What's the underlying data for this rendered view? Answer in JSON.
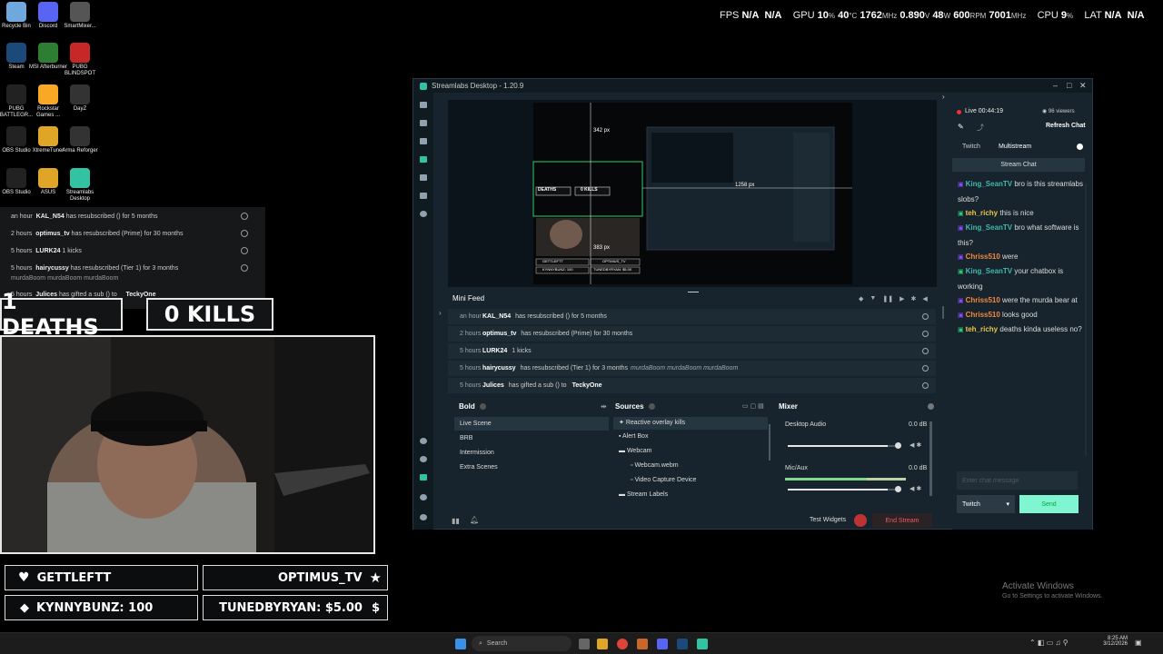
{
  "desktop_icons": [
    {
      "label": "Recycle Bin",
      "color": "#6fa8dc"
    },
    {
      "label": "Discord",
      "color": "#5865f2"
    },
    {
      "label": "SmartMixer...",
      "color": "#555"
    },
    {
      "label": "Steam",
      "color": "#1b4a7a"
    },
    {
      "label": "MSI Afterburner",
      "color": "#2d7d32"
    },
    {
      "label": "PUBG BLINDSPOT",
      "color": "#c62828"
    },
    {
      "label": "PUBG BATTLEGR...",
      "color": "#222"
    },
    {
      "label": "Rockstar Games ...",
      "color": "#f9a825"
    },
    {
      "label": "DayZ",
      "color": "#333"
    },
    {
      "label": "OBS Studio",
      "color": "#222"
    },
    {
      "label": "XtremeTuner",
      "color": "#e0a526"
    },
    {
      "label": "Arma Reforger",
      "color": "#333"
    },
    {
      "label": "OBS Studio",
      "color": "#222"
    },
    {
      "label": "ASUS",
      "color": "#e0a526"
    },
    {
      "label": "Streamlabs Desktop",
      "color": "#31c3a2"
    }
  ],
  "overlay_stats": {
    "fps_label": "FPS",
    "fps": "N/A",
    "fps2": "N/A",
    "gpu_label": "GPU",
    "gpu_pct": "10",
    "gpu_temp": "40",
    "gpu_clock": "1762",
    "gpu_volt": "0.890",
    "gpu_watt": "48",
    "gpu_rpm": "600",
    "gpu_mem": "7001",
    "cpu_label": "CPU",
    "cpu_pct": "9",
    "lat_label": "LAT",
    "lat": "N/A",
    "lat2": "N/A",
    "u_pct": "%",
    "u_temp": "°C",
    "u_mhz": "MHz",
    "u_v": "V",
    "u_w": "W",
    "u_rpm": "RPM"
  },
  "ghost_feed": [
    {
      "time": "an hour",
      "name": "KAL_N54",
      "text": "has resubscribed () for 5 months"
    },
    {
      "time": "2 hours",
      "name": "optimus_tv",
      "text": "has resubscribed (Prime) for 30 months"
    },
    {
      "time": "5 hours",
      "name": "LURK24",
      "text": "1 kicks"
    },
    {
      "time": "5 hours",
      "name": "hairycussy",
      "text": "has resubscribed (Tier 1) for 3 months"
    },
    {
      "time": "",
      "name": "",
      "text": "murdaBoom murdaBoom murdaBoom"
    },
    {
      "time": "5 hours",
      "name": "Julices",
      "text": "has gifted a sub () to"
    },
    {
      "time": "",
      "name": "TeckyOne",
      "text": ""
    }
  ],
  "counters": {
    "deaths": "1 DEATHS",
    "kills": "0 KILLS"
  },
  "labels": {
    "follower": "GETTLEFTT",
    "subscriber": "OPTIMUS_TV",
    "bits": "KYNNYBUNZ: 100",
    "donation": "TUNEDBYRYAN: $5.00",
    "dollar": "$"
  },
  "window": {
    "title": "Streamlabs Desktop - 1.20.9"
  },
  "preview": {
    "h_px": "342 px",
    "w_px": "1258 px",
    "h2_px": "383 px",
    "mini_deaths": "DEATHS",
    "mini_kills": "0 KILLS",
    "mini_follower": "GETTLEFTT",
    "mini_sub": "OPTIMUS_TV",
    "mini_bits": "KYNNYBUNZ: 100",
    "mini_don": "TUNEDBYRYAN: $5.00"
  },
  "mini_feed": {
    "title": "Mini Feed",
    "rows": [
      {
        "time": "an hour",
        "name": "KAL_N54",
        "text": "has resubscribed () for 5 months",
        "extra": "",
        "target": ""
      },
      {
        "time": "2 hours",
        "name": "optimus_tv",
        "text": "has resubscribed (Prime) for 30 months",
        "extra": "",
        "target": ""
      },
      {
        "time": "5 hours",
        "name": "LURK24",
        "text": "1 kicks",
        "extra": "",
        "target": ""
      },
      {
        "time": "5 hours",
        "name": "hairycussy",
        "text": "has resubscribed (Tier 1) for 3 months",
        "extra": "murdaBoom murdaBoom murdaBoom",
        "target": ""
      },
      {
        "time": "5 hours",
        "name": "Julices",
        "text": "has gifted a sub () to",
        "extra": "",
        "target": "TeckyOne"
      }
    ]
  },
  "scenes": {
    "title": "Bold",
    "items": [
      "Live Scene",
      "BRB",
      "Intermission",
      "Extra Scenes"
    ]
  },
  "sources": {
    "title": "Sources",
    "items": [
      "Reactive overlay kills",
      "Alert Box",
      "Webcam",
      "Webcam.webm",
      "Video Capture Device",
      "Stream Labels"
    ]
  },
  "mixer": {
    "title": "Mixer",
    "channels": [
      {
        "name": "Desktop Audio",
        "db": "0.0 dB",
        "level": 0.9
      },
      {
        "name": "Mic/Aux",
        "db": "0.0 dB",
        "level": 0.9
      }
    ]
  },
  "footer": {
    "test_widgets": "Test Widgets",
    "end_stream": "End Stream"
  },
  "chat": {
    "live": "Live 00:44:19",
    "viewers": "96 viewers",
    "refresh": "Refresh Chat",
    "tabs": [
      "Twitch",
      "Multistream"
    ],
    "subtab": "Stream Chat",
    "messages": [
      {
        "user": "King_SeanTV",
        "color": "#3fb8af",
        "text": "bro is this streamlabs slobs?"
      },
      {
        "user": "teh_richy",
        "color": "#e8c547",
        "text": "this is nice"
      },
      {
        "user": "King_SeanTV",
        "color": "#3fb8af",
        "text": "bro what software is this?"
      },
      {
        "user": "Chriss510",
        "color": "#f08a3c",
        "text": "were"
      },
      {
        "user": "King_SeanTV",
        "color": "#3fb8af",
        "text": "your chatbox is working"
      },
      {
        "user": "Chriss510",
        "color": "#f08a3c",
        "text": "were the murda bear at"
      },
      {
        "user": "Chriss510",
        "color": "#f08a3c",
        "text": "looks good"
      },
      {
        "user": "teh_richy",
        "color": "#e8c547",
        "text": "deaths kinda useless no?"
      }
    ],
    "input_placeholder": "Enter chat message",
    "platform": "Twitch",
    "send": "Send"
  },
  "activate": {
    "title": "Activate Windows",
    "sub": "Go to Settings to activate Windows."
  },
  "taskbar": {
    "search": "Search",
    "time": "8:25 AM",
    "date": "3/12/2026"
  }
}
